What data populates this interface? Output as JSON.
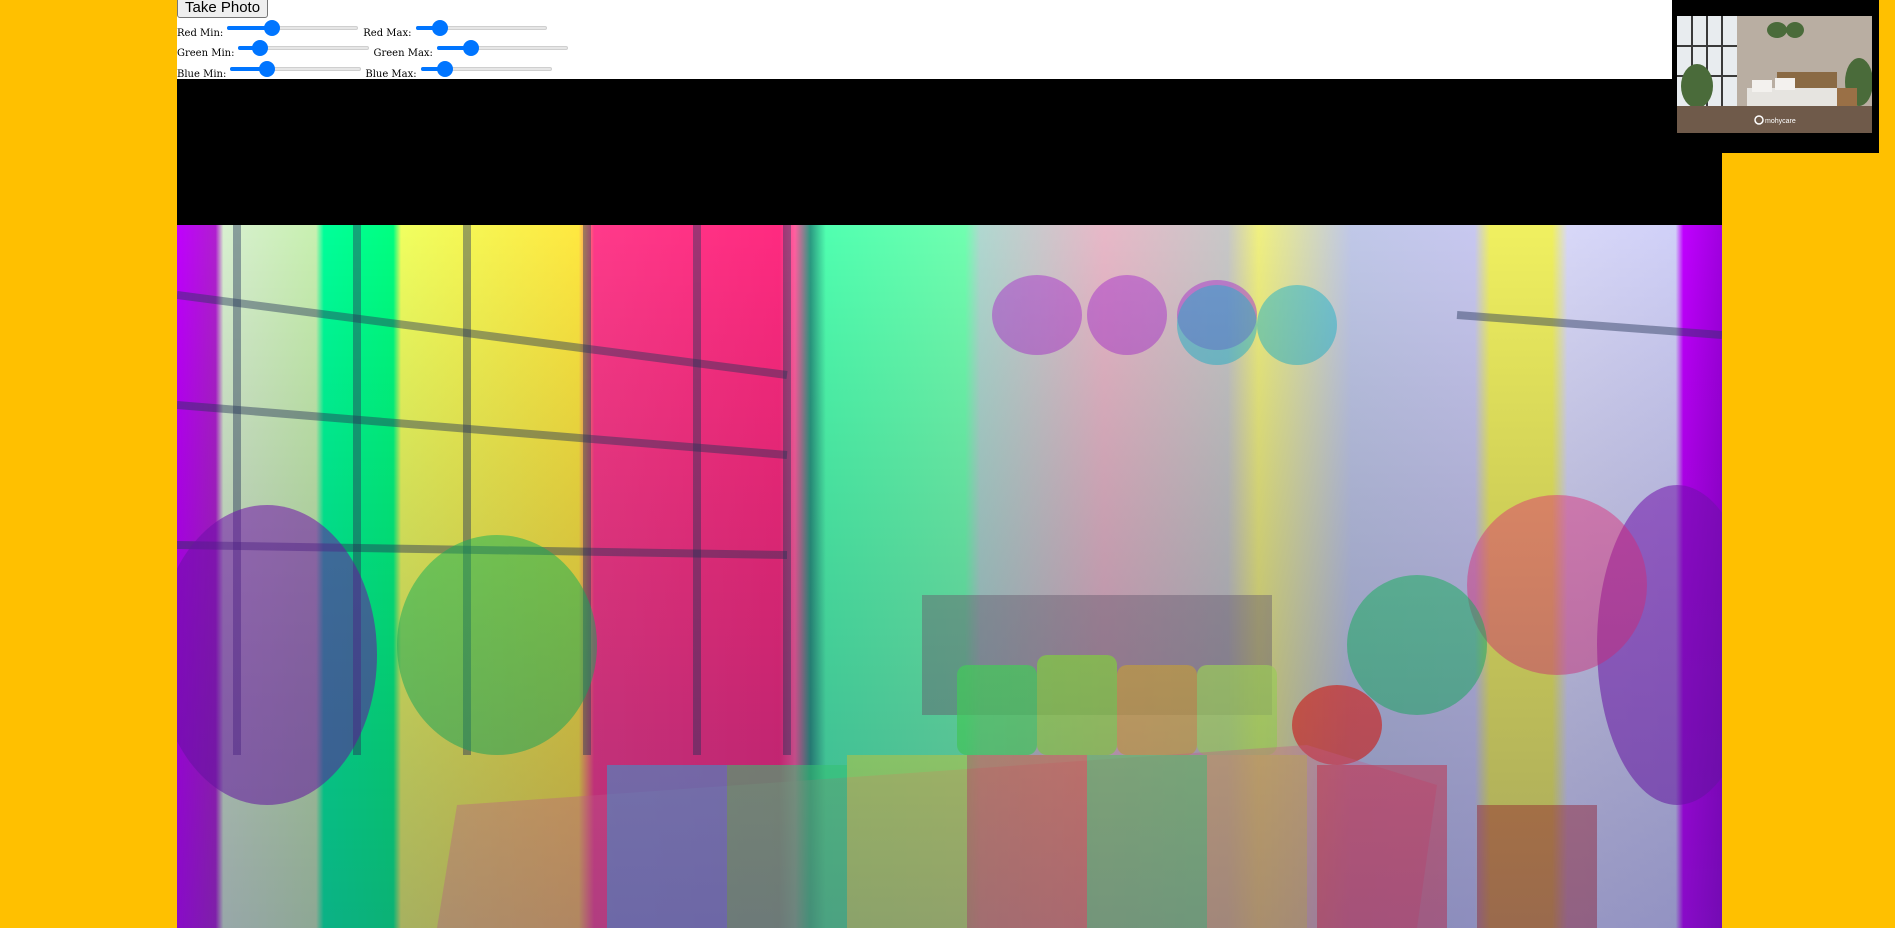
{
  "controls": {
    "take_photo_label": "Take Photo",
    "sliders": [
      {
        "id": "red-min",
        "label": "Red Min:",
        "value": 0.32
      },
      {
        "id": "red-max",
        "label": "Red Max:",
        "value": 0.14
      },
      {
        "id": "green-min",
        "label": "Green Min:",
        "value": 0.12
      },
      {
        "id": "green-max",
        "label": "Green Max:",
        "value": 0.23
      },
      {
        "id": "blue-min",
        "label": "Blue Min:",
        "value": 0.25
      },
      {
        "id": "blue-max",
        "label": "Blue Max:",
        "value": 0.14
      }
    ]
  },
  "colors": {
    "page_background": "#ffc000",
    "slider_accent": "#0075ff",
    "video_background": "#000000"
  },
  "preview": {
    "watermark": "mohycare"
  },
  "canvas": {
    "description_icon": "filtered-bedroom-image"
  }
}
